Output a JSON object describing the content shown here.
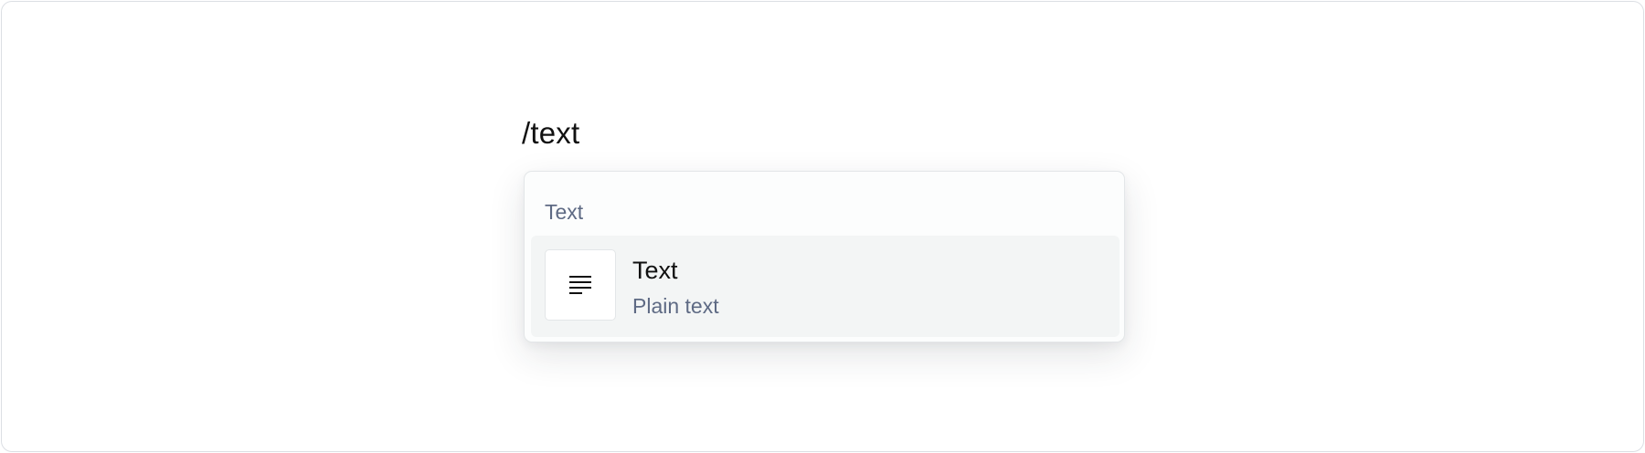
{
  "editor": {
    "input_text": "/text"
  },
  "slash_menu": {
    "group_label": "Text",
    "items": [
      {
        "title": "Text",
        "description": "Plain text",
        "icon": "paragraph-lines-icon",
        "highlighted": true
      }
    ]
  },
  "colors": {
    "muted_text": "#5e6a84",
    "highlight_bg": "#f3f5f5"
  }
}
